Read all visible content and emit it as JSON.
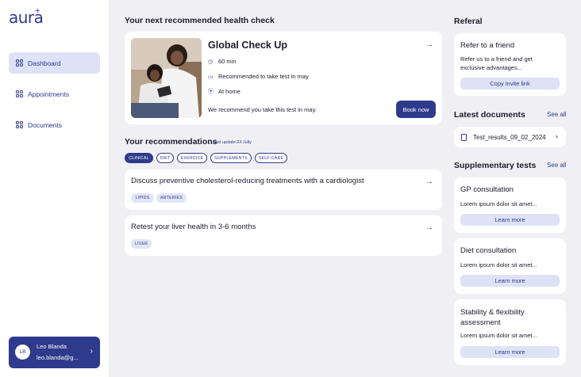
{
  "brand": {
    "logo": "aura",
    "logo_mark": "+"
  },
  "sidebar": {
    "items": [
      {
        "label": "Dashboard",
        "icon": "grid-icon"
      },
      {
        "label": "Appointments",
        "icon": "grid-icon"
      },
      {
        "label": "Documents",
        "icon": "grid-icon"
      }
    ]
  },
  "user": {
    "initials": "LB",
    "name": "Leo Blanda",
    "email": "leo.blanda@g..."
  },
  "health_check": {
    "section_title": "Your next recommended health check",
    "title": "Global Check Up",
    "duration": "60 min",
    "recommendation": "Recommended to take test in may",
    "location": "At home",
    "note": "We recommend you take this test in may.",
    "button": "Book now"
  },
  "recommendations": {
    "section_title": "Your recommendations",
    "last_update": "Last update 23 Jully",
    "filters": [
      "CLINICAL",
      "DIET",
      "EXERCICE",
      "SUPPLEMENTS",
      "SELF-CARE"
    ],
    "items": [
      {
        "title": "Discuss preventive cholesterol-reducing treatments with a cardiologist",
        "tags": [
          "LIPIDS",
          "ARTERIES"
        ]
      },
      {
        "title": "Retest your liver health in 3-6 months",
        "tags": [
          "LIVER"
        ]
      }
    ]
  },
  "referral": {
    "section_title": "Referal",
    "card_title": "Refer to a friend",
    "text": "Refer us to a friend and get exclusive advantages...",
    "button": "Copy invite link"
  },
  "documents": {
    "section_title": "Latest documents",
    "see_all": "See all",
    "file": "Test_results_09_02_2024"
  },
  "supplementary": {
    "section_title": "Supplementary tests",
    "see_all": "See all",
    "items": [
      {
        "title": "GP consultation",
        "text": "Lorem ipsum dolor sit amet...",
        "button": "Learn more"
      },
      {
        "title": "Diet consultation",
        "text": "Lorem ipsum dolor sit amet...",
        "button": "Learn more"
      },
      {
        "title": "Stability & flexibility assessment",
        "text": "Lorem ipsum dolor sit amet...",
        "button": "Learn more"
      }
    ]
  },
  "colors": {
    "accent": "#2e3a8c",
    "accent_light": "#dde2f6",
    "background": "#f0f0f4"
  }
}
